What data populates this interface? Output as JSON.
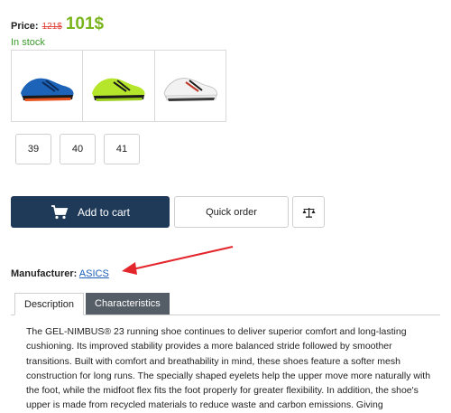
{
  "price": {
    "label": "Price:",
    "old": "121$",
    "current": "101$"
  },
  "stock_status": "In stock",
  "thumbnails": [
    {
      "name": "blue-shoe"
    },
    {
      "name": "lime-shoe"
    },
    {
      "name": "white-shoe"
    }
  ],
  "sizes": [
    "39",
    "40",
    "41"
  ],
  "buttons": {
    "add_to_cart": "Add to cart",
    "quick_order": "Quick order",
    "compare_icon": "scales-icon",
    "cart_icon": "cart-icon"
  },
  "manufacturer": {
    "label": "Manufacturer:",
    "value": "ASICS"
  },
  "tabs": [
    {
      "label": "Description",
      "active": true
    },
    {
      "label": "Characteristics",
      "active": false
    }
  ],
  "description": "The GEL-NIMBUS® 23 running shoe continues to deliver superior comfort and long-lasting cushioning. Its improved stability provides a more balanced stride followed by smoother transitions. Built with comfort and breathability in mind, these shoes feature a softer mesh construction for long runs. The specially shaped eyelets help the upper move more naturally with the foot, while the midfoot flex fits the foot properly for greater flexibility. In addition, the shoe's upper is made from recycled materials to reduce waste and carbon emissions. Giving",
  "colors": {
    "accent": "#1f3a58",
    "price_new": "#7ab51d",
    "price_old": "#e0453a",
    "stock": "#3a9b2c",
    "arrow": "#e3262b",
    "link": "#1b5fb8"
  }
}
